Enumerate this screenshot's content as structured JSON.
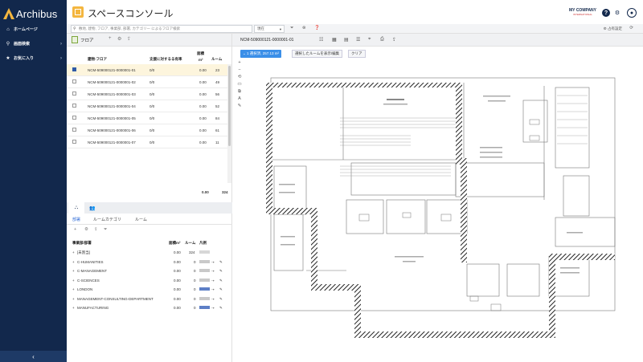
{
  "brand": {
    "name": "Archibus"
  },
  "sidebar": {
    "items": [
      {
        "icon": "home-icon",
        "label": "ホームページ"
      },
      {
        "icon": "search-icon",
        "label": "画面検索"
      },
      {
        "icon": "star-icon",
        "label": "お気に入り"
      }
    ],
    "collapse_label": "‹"
  },
  "header": {
    "title": "スペースコンソール",
    "company": "MY COMPANY",
    "company_sub": "INTERNATIONAL"
  },
  "filter_bar": {
    "search_placeholder": "敷地, 建物, フロア, 事業部, 部署, カテゴリー によるフロア検索",
    "select_value": "現在",
    "right_label": "占有設定"
  },
  "floor_panel": {
    "title": "フロア",
    "columns": {
      "building_floor": "建物-フロア",
      "occupancy": "支援に対するる有率",
      "area": "面積",
      "area_unit": "m²",
      "rooms": "ルーム"
    },
    "rows": [
      {
        "code": "NCM-509000121-0000001-01",
        "occ": "0/0",
        "area": "0.00",
        "rooms": "23",
        "selected": true
      },
      {
        "code": "NCM-509000121-0000001-02",
        "occ": "0/0",
        "area": "0.00",
        "rooms": "49",
        "selected": false
      },
      {
        "code": "NCM-509000121-0000001-03",
        "occ": "0/0",
        "area": "0.00",
        "rooms": "56",
        "selected": false
      },
      {
        "code": "NCM-509000121-0000001-04",
        "occ": "0/0",
        "area": "0.00",
        "rooms": "52",
        "selected": false
      },
      {
        "code": "NCM-509000121-0000001-05",
        "occ": "0/0",
        "area": "0.00",
        "rooms": "84",
        "selected": false
      },
      {
        "code": "NCM-509000121-0000001-06",
        "occ": "0/0",
        "area": "0.00",
        "rooms": "61",
        "selected": false
      },
      {
        "code": "NCM-509000121-0000001-07",
        "occ": "0/0",
        "area": "0.00",
        "rooms": "11",
        "selected": false
      }
    ],
    "totals": {
      "area": "0.00",
      "rooms": "324"
    }
  },
  "detail_panel": {
    "subtabs": [
      "部署",
      "ルームカテゴリ",
      "ルーム"
    ],
    "columns": {
      "division": "事業部/部署",
      "area": "面積m²",
      "rooms": "ルーム",
      "legend": "凡例"
    },
    "rows": [
      {
        "name": "[未割当]",
        "area": "0.00",
        "rooms": "324",
        "legend": "none"
      },
      {
        "name": "C-HUMANITIES",
        "area": "0.00",
        "rooms": "0",
        "legend": "gray"
      },
      {
        "name": "C-MANAGEMENT",
        "area": "0.00",
        "rooms": "0",
        "legend": "gray"
      },
      {
        "name": "C-SCIENCES",
        "area": "0.00",
        "rooms": "0",
        "legend": "gray"
      },
      {
        "name": "LONDON",
        "area": "0.00",
        "rooms": "0",
        "legend": "blue"
      },
      {
        "name": "MANAGEMENT-CONSULTING-DEPARTMENT",
        "area": "0.00",
        "rooms": "0",
        "legend": "gray"
      },
      {
        "name": "MANUFACTURING",
        "area": "0.00",
        "rooms": "0",
        "legend": "blue"
      }
    ]
  },
  "drawing_panel": {
    "title": "NCM-509000121-0000001-01",
    "selection_badge": "1 選択済, 257.13 m²",
    "show_selected_label": "選択したルームを表示/編集",
    "clear_label": "クリア"
  },
  "colors": {
    "sidebar": "#12284c",
    "accent": "#f4b63f",
    "selected_row": "#fdf5dd",
    "badge": "#3b8fe8"
  }
}
